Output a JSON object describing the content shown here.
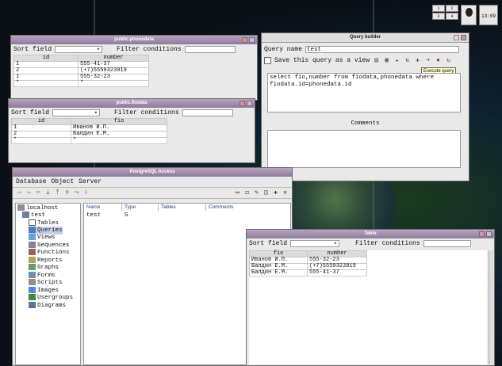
{
  "colors": {
    "title_bar": "#8e7b9a",
    "tooltip": "#ffffc8",
    "header_text": "#2b3f80"
  },
  "phonedata": {
    "title": "public.phonedata",
    "sort_label": "Sort field",
    "filter_label": "Filter conditions",
    "columns": [
      "id",
      "number"
    ],
    "rows": [
      [
        "1",
        "555-41-37"
      ],
      [
        "2",
        "(+7)5559323919"
      ],
      [
        "1",
        "555-32-23"
      ],
      [
        "*",
        "*"
      ]
    ]
  },
  "fiodata": {
    "title": "public.fiodata",
    "sort_label": "Sort field",
    "filter_label": "Filter conditions",
    "columns": [
      "id",
      "fio"
    ],
    "rows": [
      [
        "1",
        "Иванов И.П."
      ],
      [
        "2",
        "Балдин Е.М."
      ],
      [
        "*",
        "*"
      ]
    ]
  },
  "query_builder": {
    "title": "Query builder",
    "query_name_label": "Query name",
    "query_name_value": "test",
    "save_label": "Save this query as a view",
    "sql_line1": "select fio,number from fiodata,phonedata where",
    "sql_line2": "fiodata.id=phonedata.id",
    "tooltip": "Execute query",
    "comments_label": "Comments"
  },
  "pgaccess": {
    "title": "PostgreSQL Access",
    "menu": [
      "Database",
      "Object",
      "Server"
    ],
    "tree_root": "localhost",
    "tree_db": "test",
    "tree_items": [
      "Tables",
      "Queries",
      "Views",
      "Sequences",
      "Functions",
      "Reports",
      "Graphs",
      "Forms",
      "Scripts",
      "Images",
      "Usergroups",
      "Diagrams"
    ],
    "list_columns": [
      "Name",
      "Type",
      "Tables",
      "Comments"
    ],
    "list_row": [
      "test",
      "S",
      "",
      ""
    ]
  },
  "table_window": {
    "title": "Table",
    "sort_label": "Sort field",
    "filter_label": "Filter conditions",
    "columns": [
      "fio",
      "number"
    ],
    "rows": [
      [
        "Иванов И.П.",
        "555-32-23"
      ],
      [
        "Балдин Е.М.",
        "(+7)5559323919"
      ],
      [
        "Балдин Е.М.",
        "555-41-37"
      ]
    ]
  },
  "pager": {
    "cells": [
      "1",
      "2",
      "3",
      "4"
    ],
    "clock": "13:09"
  }
}
